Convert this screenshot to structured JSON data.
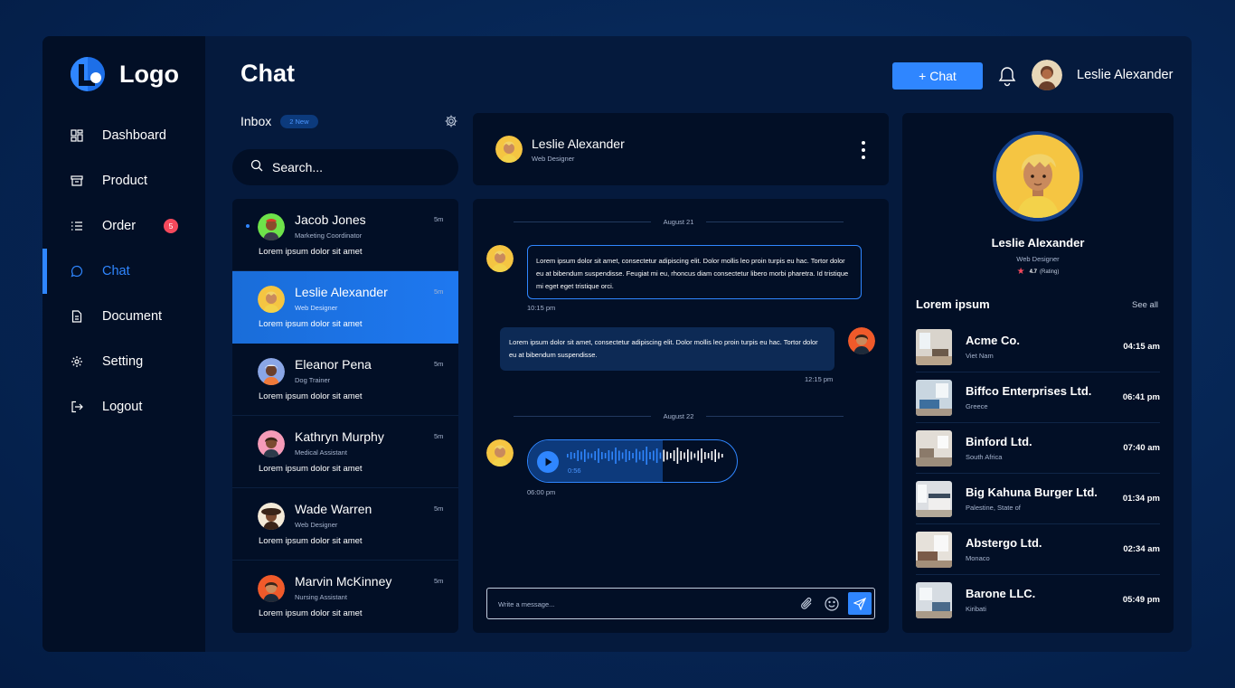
{
  "brand": {
    "name": "Logo"
  },
  "colors": {
    "accent": "#2f86ff",
    "background": "#051a3d",
    "panel": "#020f26",
    "badge": "#f5495c"
  },
  "sidebar": {
    "items": [
      {
        "label": "Dashboard",
        "icon": "dashboard-icon"
      },
      {
        "label": "Product",
        "icon": "archive-icon"
      },
      {
        "label": "Order",
        "icon": "list-icon",
        "badge": "5"
      },
      {
        "label": "Chat",
        "icon": "chat-bubble-icon",
        "active": true
      },
      {
        "label": "Document",
        "icon": "document-icon"
      },
      {
        "label": "Setting",
        "icon": "gear-icon"
      },
      {
        "label": "Logout",
        "icon": "logout-icon"
      }
    ]
  },
  "header": {
    "title": "Chat",
    "new_chat_label": "+ Chat",
    "user_name": "Leslie Alexander"
  },
  "inbox": {
    "label": "Inbox",
    "badge": "2 New",
    "search_placeholder": "Search...",
    "chats": [
      {
        "name": "Jacob Jones",
        "role": "Marketing Coordinator",
        "time": "5m",
        "message": "Lorem ipsum dolor sit amet",
        "unread": true
      },
      {
        "name": "Leslie Alexander",
        "role": "Web Designer",
        "time": "5m",
        "message": "Lorem ipsum dolor sit amet",
        "active": true
      },
      {
        "name": "Eleanor Pena",
        "role": "Dog Trainer",
        "time": "5m",
        "message": "Lorem ipsum dolor sit amet"
      },
      {
        "name": "Kathryn Murphy",
        "role": "Medical Assistant",
        "time": "5m",
        "message": "Lorem ipsum dolor sit amet"
      },
      {
        "name": "Wade Warren",
        "role": "Web Designer",
        "time": "5m",
        "message": "Lorem ipsum dolor sit amet"
      },
      {
        "name": "Marvin McKinney",
        "role": "Nursing Assistant",
        "time": "5m",
        "message": "Lorem ipsum dolor sit amet"
      }
    ]
  },
  "conversation": {
    "contact_name": "Leslie Alexander",
    "contact_role": "Web Designer",
    "date_1": "August 21",
    "incoming_text": "Lorem ipsum dolor sit amet, consectetur adipiscing elit. Dolor mollis leo proin turpis eu hac. Tortor dolor eu at bibendum suspendisse. Feugiat mi eu, rhoncus diam consectetur libero morbi pharetra. Id tristique mi eget eget tristique orci.",
    "incoming_time": "10:15 pm",
    "outgoing_text": "Lorem ipsum dolor sit amet, consectetur adipiscing elit. Dolor mollis leo proin turpis eu hac. Tortor dolor eu at bibendum suspendisse.",
    "outgoing_time": "12:15 pm",
    "date_2": "August 22",
    "voice_duration": "0:56",
    "voice_progress": 0.64,
    "voice_time": "06:00 pm",
    "composer_placeholder": "Write a message..."
  },
  "profile": {
    "name": "Leslie Alexander",
    "role": "Web Designer",
    "rating": "4.7",
    "rating_label": "(Rating)",
    "section_title": "Lorem ipsum",
    "see_all": "See all",
    "companies": [
      {
        "name": "Acme Co.",
        "location": "Viet Nam",
        "time": "04:15 am"
      },
      {
        "name": "Biffco Enterprises Ltd.",
        "location": "Greece",
        "time": "06:41 pm"
      },
      {
        "name": "Binford Ltd.",
        "location": "South Africa",
        "time": "07:40 am"
      },
      {
        "name": "Big Kahuna Burger Ltd.",
        "location": "Palestine, State of",
        "time": "01:34 pm"
      },
      {
        "name": "Abstergo Ltd.",
        "location": "Monaco",
        "time": "02:34 am"
      },
      {
        "name": "Barone LLC.",
        "location": "Kiribati",
        "time": "05:49 pm"
      }
    ]
  }
}
